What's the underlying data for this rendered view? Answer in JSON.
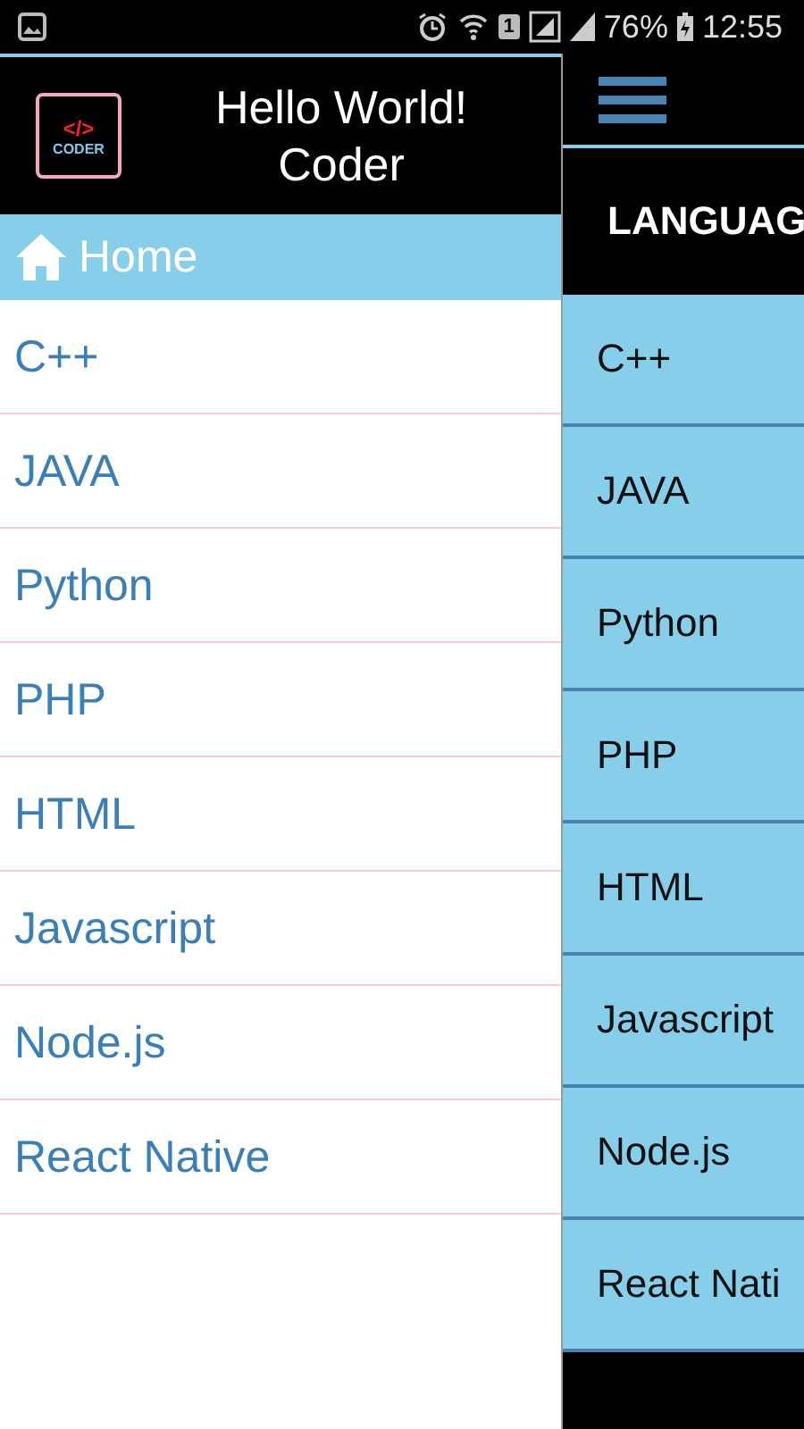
{
  "status_bar": {
    "sim_slot": "1",
    "battery": "76%",
    "time": "12:55"
  },
  "drawer": {
    "title": "Hello World!\nCoder",
    "logo": {
      "tag": "</>",
      "word": "CODER"
    },
    "items": [
      {
        "kind": "home",
        "label": "Home",
        "selected": true
      },
      {
        "kind": "plain",
        "label": "C++",
        "selected": false
      },
      {
        "kind": "plain",
        "label": "JAVA",
        "selected": false
      },
      {
        "kind": "plain",
        "label": "Python",
        "selected": false
      },
      {
        "kind": "plain",
        "label": "PHP",
        "selected": false
      },
      {
        "kind": "plain",
        "label": "HTML",
        "selected": false
      },
      {
        "kind": "plain",
        "label": "Javascript",
        "selected": false
      },
      {
        "kind": "plain",
        "label": "Node.js",
        "selected": false
      },
      {
        "kind": "plain",
        "label": "React Native",
        "selected": false
      }
    ]
  },
  "main": {
    "heading": "LANGUAG",
    "languages": [
      "C++",
      "JAVA",
      "Python",
      "PHP",
      "HTML",
      "Javascript",
      "Node.js",
      "React Nati"
    ]
  }
}
